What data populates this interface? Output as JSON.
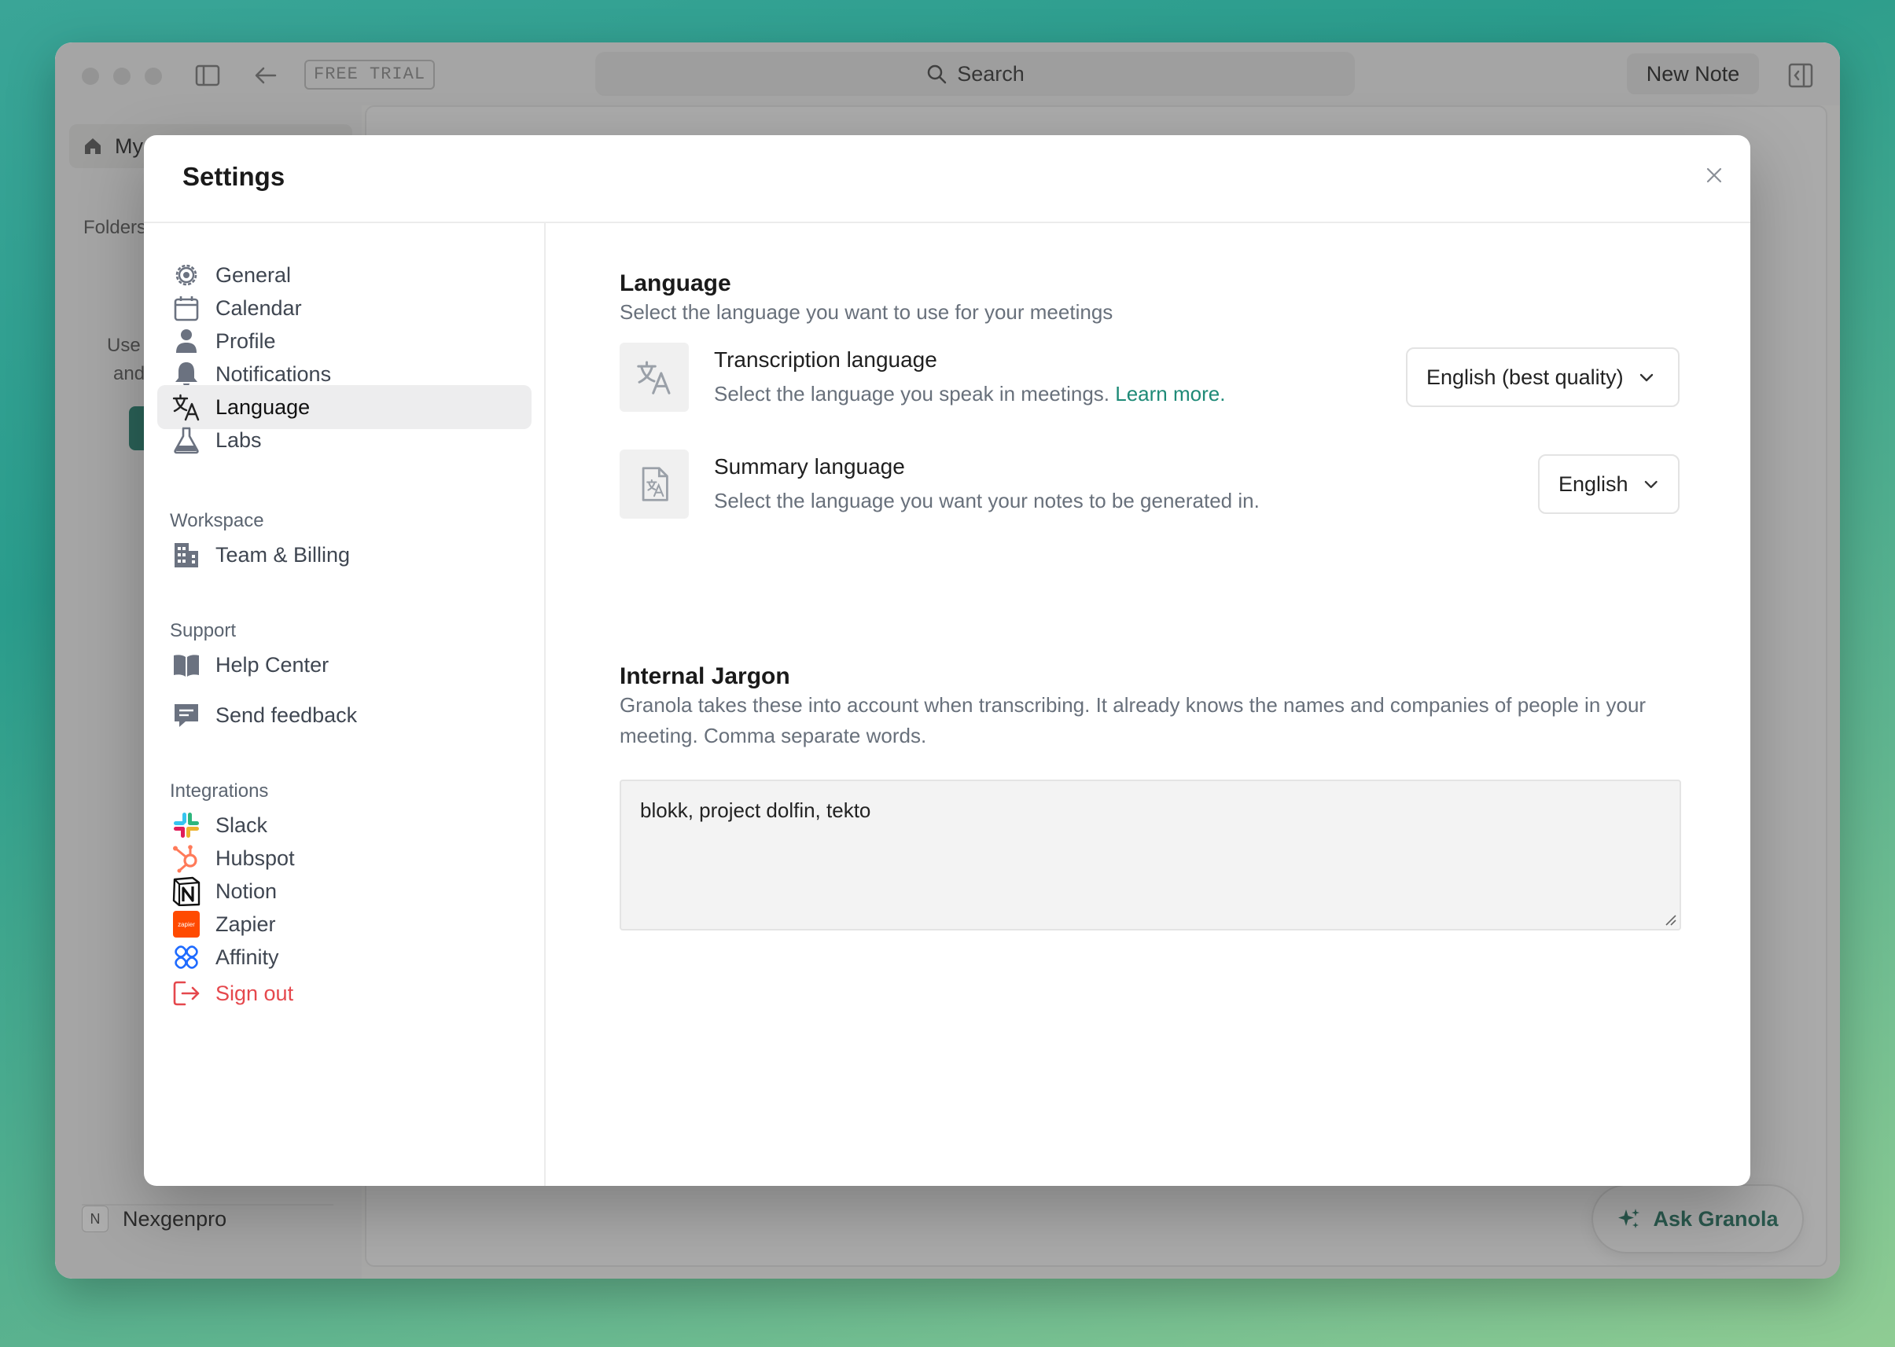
{
  "window": {
    "free_trial": "FREE TRIAL",
    "search_label": "Search",
    "new_note_label": "New Note",
    "home_label": "My",
    "folders_label": "Folders",
    "bg_use": "Use",
    "bg_and": "and",
    "user_initial": "N",
    "user_name": "Nexgenpro",
    "ask_granola": "Ask Granola"
  },
  "settings": {
    "title": "Settings",
    "nav": {
      "main": [
        {
          "label": "General",
          "icon": "gear-icon"
        },
        {
          "label": "Calendar",
          "icon": "calendar-icon"
        },
        {
          "label": "Profile",
          "icon": "person-icon"
        },
        {
          "label": "Notifications",
          "icon": "bell-icon"
        },
        {
          "label": "Language",
          "icon": "translate-icon"
        },
        {
          "label": "Labs",
          "icon": "flask-icon"
        }
      ],
      "workspace_heading": "Workspace",
      "workspace": [
        {
          "label": "Team & Billing",
          "icon": "building-icon"
        }
      ],
      "support_heading": "Support",
      "support": [
        {
          "label": "Help Center",
          "icon": "book-icon"
        },
        {
          "label": "Send feedback",
          "icon": "chat-icon"
        }
      ],
      "integrations_heading": "Integrations",
      "integrations": [
        {
          "label": "Slack",
          "icon": "slack-icon"
        },
        {
          "label": "Hubspot",
          "icon": "hubspot-icon"
        },
        {
          "label": "Notion",
          "icon": "notion-icon"
        },
        {
          "label": "Zapier",
          "icon": "zapier-icon",
          "icon_text": "zapier"
        },
        {
          "label": "Affinity",
          "icon": "affinity-icon"
        }
      ],
      "sign_out": "Sign out",
      "active": "Language"
    },
    "language": {
      "title": "Language",
      "description": "Select the language you want to use for your meetings",
      "transcription": {
        "title": "Transcription language",
        "description": "Select the language you speak in meetings.",
        "link": "Learn more.",
        "value": "English (best quality)"
      },
      "summary": {
        "title": "Summary language",
        "description": "Select the language you want your notes to be generated in.",
        "value": "English"
      }
    },
    "jargon": {
      "title": "Internal Jargon",
      "description": "Granola takes these into account when transcribing. It already knows the names and companies of people in your meeting. Comma separate words.",
      "value": "blokk, project dolfin, tekto"
    }
  },
  "colors": {
    "accent": "#1e8a77",
    "danger": "#e5484d",
    "active_nav_bg": "#ededee"
  }
}
